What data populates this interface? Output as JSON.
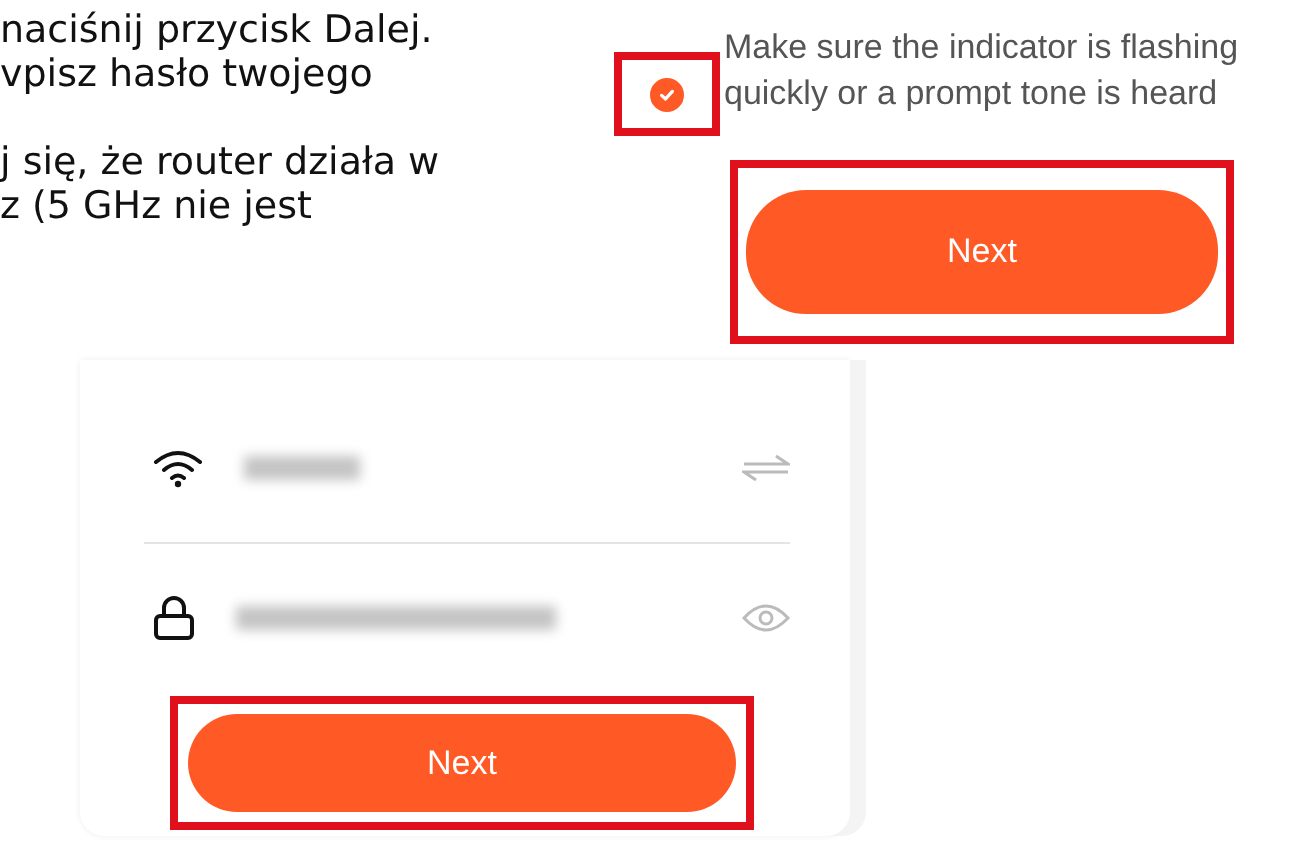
{
  "article": {
    "paragraphs": [
      {
        "lines": [
          "naciśnij przycisk Dalej.",
          "vpisz hasło twojego"
        ]
      },
      {
        "lines": [
          "j się, że router działa w",
          "z (5 GHz nie jest"
        ]
      }
    ]
  },
  "confirm_screen": {
    "checkbox": {
      "checked": true,
      "label": "Make sure the indicator is flashing quickly or a prompt tone is heard",
      "highlighted": true
    },
    "button": {
      "label": "Next",
      "highlighted": true
    }
  },
  "wifi_screen": {
    "fields": [
      {
        "kind": "network"
      },
      {
        "kind": "password"
      }
    ],
    "button": {
      "label": "Next",
      "highlighted": true
    }
  }
}
